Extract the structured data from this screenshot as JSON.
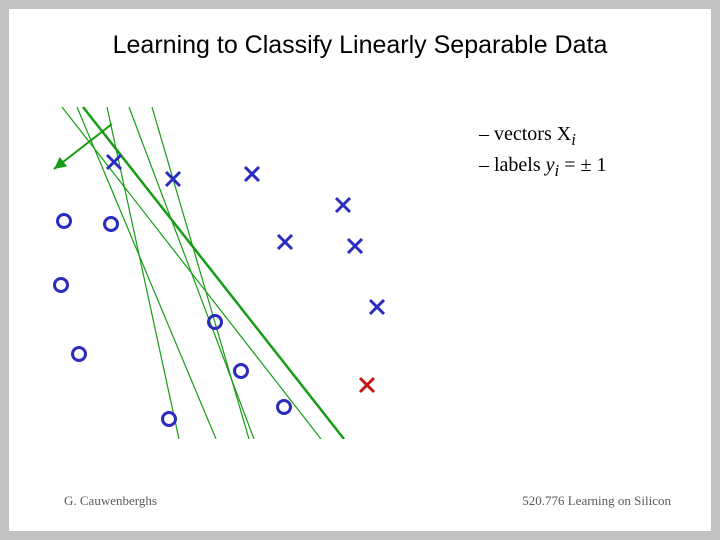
{
  "title": "Learning to Classify Linearly Separable Data",
  "bullets": {
    "b1_prefix": "–   vectors  ",
    "b1_sym": "X",
    "b1_sub": "i",
    "b2_prefix": "–   labels   ",
    "b2_sym": "y",
    "b2_sub": "i",
    "b2_tail": " = ± 1"
  },
  "footer": {
    "left": "G. Cauwenberghs",
    "right": "520.776 Learning on Silicon"
  },
  "chart_data": {
    "type": "scatter",
    "title": "",
    "xlabel": "",
    "ylabel": "",
    "xlim": [
      0,
      430
    ],
    "ylim": [
      0,
      350
    ],
    "markers": {
      "circles": [
        {
          "x": 30,
          "y": 132
        },
        {
          "x": 77,
          "y": 135
        },
        {
          "x": 27,
          "y": 196
        },
        {
          "x": 181,
          "y": 233
        },
        {
          "x": 45,
          "y": 265
        },
        {
          "x": 207,
          "y": 282
        },
        {
          "x": 135,
          "y": 330
        },
        {
          "x": 250,
          "y": 318
        }
      ],
      "crosses": [
        {
          "x": 80,
          "y": 73
        },
        {
          "x": 139,
          "y": 90
        },
        {
          "x": 218,
          "y": 85
        },
        {
          "x": 309,
          "y": 116
        },
        {
          "x": 251,
          "y": 153
        },
        {
          "x": 321,
          "y": 157
        },
        {
          "x": 343,
          "y": 218
        },
        {
          "x": 333,
          "y": 296
        }
      ]
    },
    "lines": [
      {
        "color": "#169c16",
        "x1": 28,
        "y1": 18,
        "x2": 287,
        "y2": 350,
        "thick": false
      },
      {
        "color": "#169c16",
        "x1": 43,
        "y1": 18,
        "x2": 182,
        "y2": 350,
        "thick": false
      },
      {
        "color": "#169c16",
        "x1": 73,
        "y1": 18,
        "x2": 145,
        "y2": 350,
        "thick": false
      },
      {
        "color": "#169c16",
        "x1": 95,
        "y1": 18,
        "x2": 220,
        "y2": 350,
        "thick": false
      },
      {
        "color": "#169c16",
        "x1": 118,
        "y1": 18,
        "x2": 215,
        "y2": 350,
        "thick": false
      },
      {
        "color": "#169c16",
        "x1": 49,
        "y1": 18,
        "x2": 310,
        "y2": 350,
        "thick": true
      }
    ],
    "arrow": {
      "x1": 78,
      "y1": 35,
      "x2": 20,
      "y2": 80
    }
  },
  "colors": {
    "marker": "#2b2bbf",
    "line_green": "#169c16",
    "marker_red_special": "#c21a1a"
  }
}
